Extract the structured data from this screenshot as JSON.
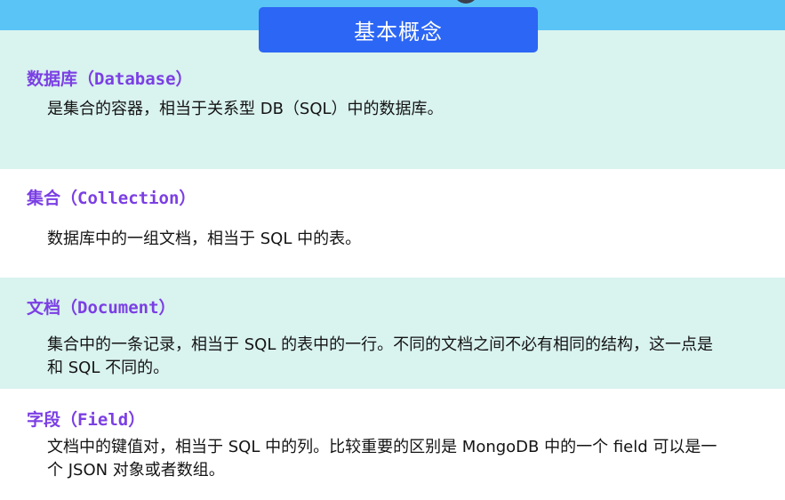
{
  "title": "基本概念",
  "concepts": [
    {
      "term": "数据库（Database）",
      "desc": "是集合的容器，相当于关系型 DB（SQL）中的数据库。"
    },
    {
      "term": "集合（Collection）",
      "desc": "数据库中的一组文档，相当于 SQL 中的表。"
    },
    {
      "term": "文档（Document）",
      "desc": "集合中的一条记录，相当于 SQL 的表中的一行。不同的文档之间不必有相同的结构，这一点是和 SQL 不同的。"
    },
    {
      "term": "字段（Field）",
      "desc": "文档中的键值对，相当于 SQL 中的列。比较重要的区别是 MongoDB 中的一个 field 可以是一个 JSON 对象或者数组。"
    }
  ],
  "colors": {
    "header_band": "#5bc4f6",
    "title_box": "#2c66f5",
    "term_text": "#7b3fe4",
    "teal_band": "#d9f3ef"
  }
}
